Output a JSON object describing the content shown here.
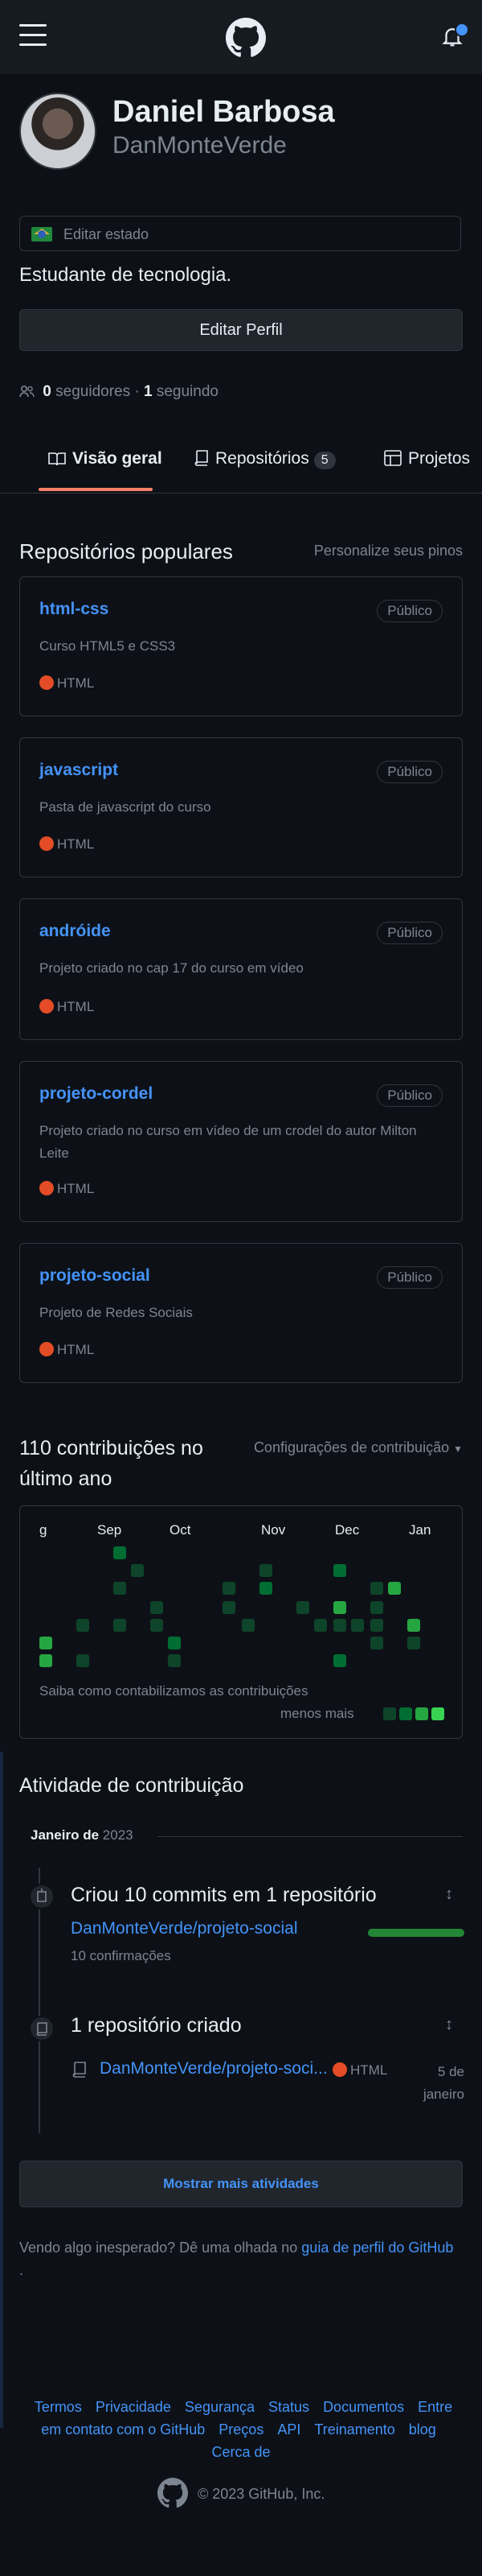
{
  "header": {
    "menu_icon": "hamburger-icon",
    "logo_icon": "github-logo-icon",
    "notification_icon": "bell-icon"
  },
  "profile": {
    "name": "Daniel Barbosa",
    "login": "DanMonteVerde",
    "status_text": "Editar estado",
    "status_emoji": "brazil-flag",
    "bio": "Estudante de tecnologia.",
    "edit_button": "Editar Perfil",
    "followers_count": "0",
    "followers_label": "seguidores",
    "dot": "·",
    "following_count": "1",
    "following_label": "seguindo"
  },
  "tabs": [
    {
      "label": "Visão geral",
      "icon": "book-icon",
      "active": true
    },
    {
      "label": "Repositórios",
      "icon": "repo-icon",
      "count": "5"
    },
    {
      "label": "Projetos",
      "icon": "table-icon"
    }
  ],
  "pinned": {
    "title": "Repositórios populares",
    "customize": "Personalize seus pinos",
    "repos": [
      {
        "name": "html-css",
        "visibility": "Público",
        "description": "Curso HTML5 e CSS3",
        "language": "HTML"
      },
      {
        "name": "javascript",
        "visibility": "Público",
        "description": "Pasta de javascript do curso",
        "language": "HTML"
      },
      {
        "name": "andróide",
        "visibility": "Público",
        "description": "Projeto criado no cap 17 do curso em vídeo",
        "language": "HTML"
      },
      {
        "name": "projeto-cordel",
        "visibility": "Público",
        "description": "Projeto criado no curso em vídeo de um crodel do autor Milton Leite",
        "language": "HTML"
      },
      {
        "name": "projeto-social",
        "visibility": "Público",
        "description": "Projeto de Redes Sociais",
        "language": "HTML"
      }
    ],
    "language_color": "#e34c26"
  },
  "contributions": {
    "title": "110 contribuições no último ano",
    "settings": "Configurações de contribuição",
    "months": [
      "g",
      "Sep",
      "Oct",
      "Nov",
      "Dec",
      "Jan"
    ],
    "learn": "Saiba como contabilizamos as contribuições",
    "less_more": "menos mais",
    "colors": [
      "#0e4429",
      "#006d32",
      "#26a641",
      "#39d353"
    ]
  },
  "activity": {
    "title": "Atividade de contribuição",
    "month": "Janeiro de",
    "year": "2023",
    "commits_title": "Criou 10 commits em 1 repositório",
    "commits_repo": "DanMonteVerde/projeto-social",
    "commits_count": "10 confirmações",
    "created_title": "1 repositório criado",
    "created_repo": "DanMonteVerde/projeto-soci...",
    "created_language": "HTML",
    "created_date": "5 de janeiro",
    "show_more": "Mostrar mais atividades",
    "unexpected_prefix": "Vendo algo inesperado? Dê uma olhada no",
    "unexpected_link": "guia de perfil do GitHub",
    "unexpected_suffix": "."
  },
  "footer": {
    "links": [
      "Termos",
      "Privacidade",
      "Segurança",
      "Status",
      "Documentos",
      "Entre em contato com o GitHub",
      "Preços",
      "API",
      "Treinamento",
      "blog",
      "Cerca de"
    ],
    "copyright": "© 2023 GitHub, Inc."
  }
}
